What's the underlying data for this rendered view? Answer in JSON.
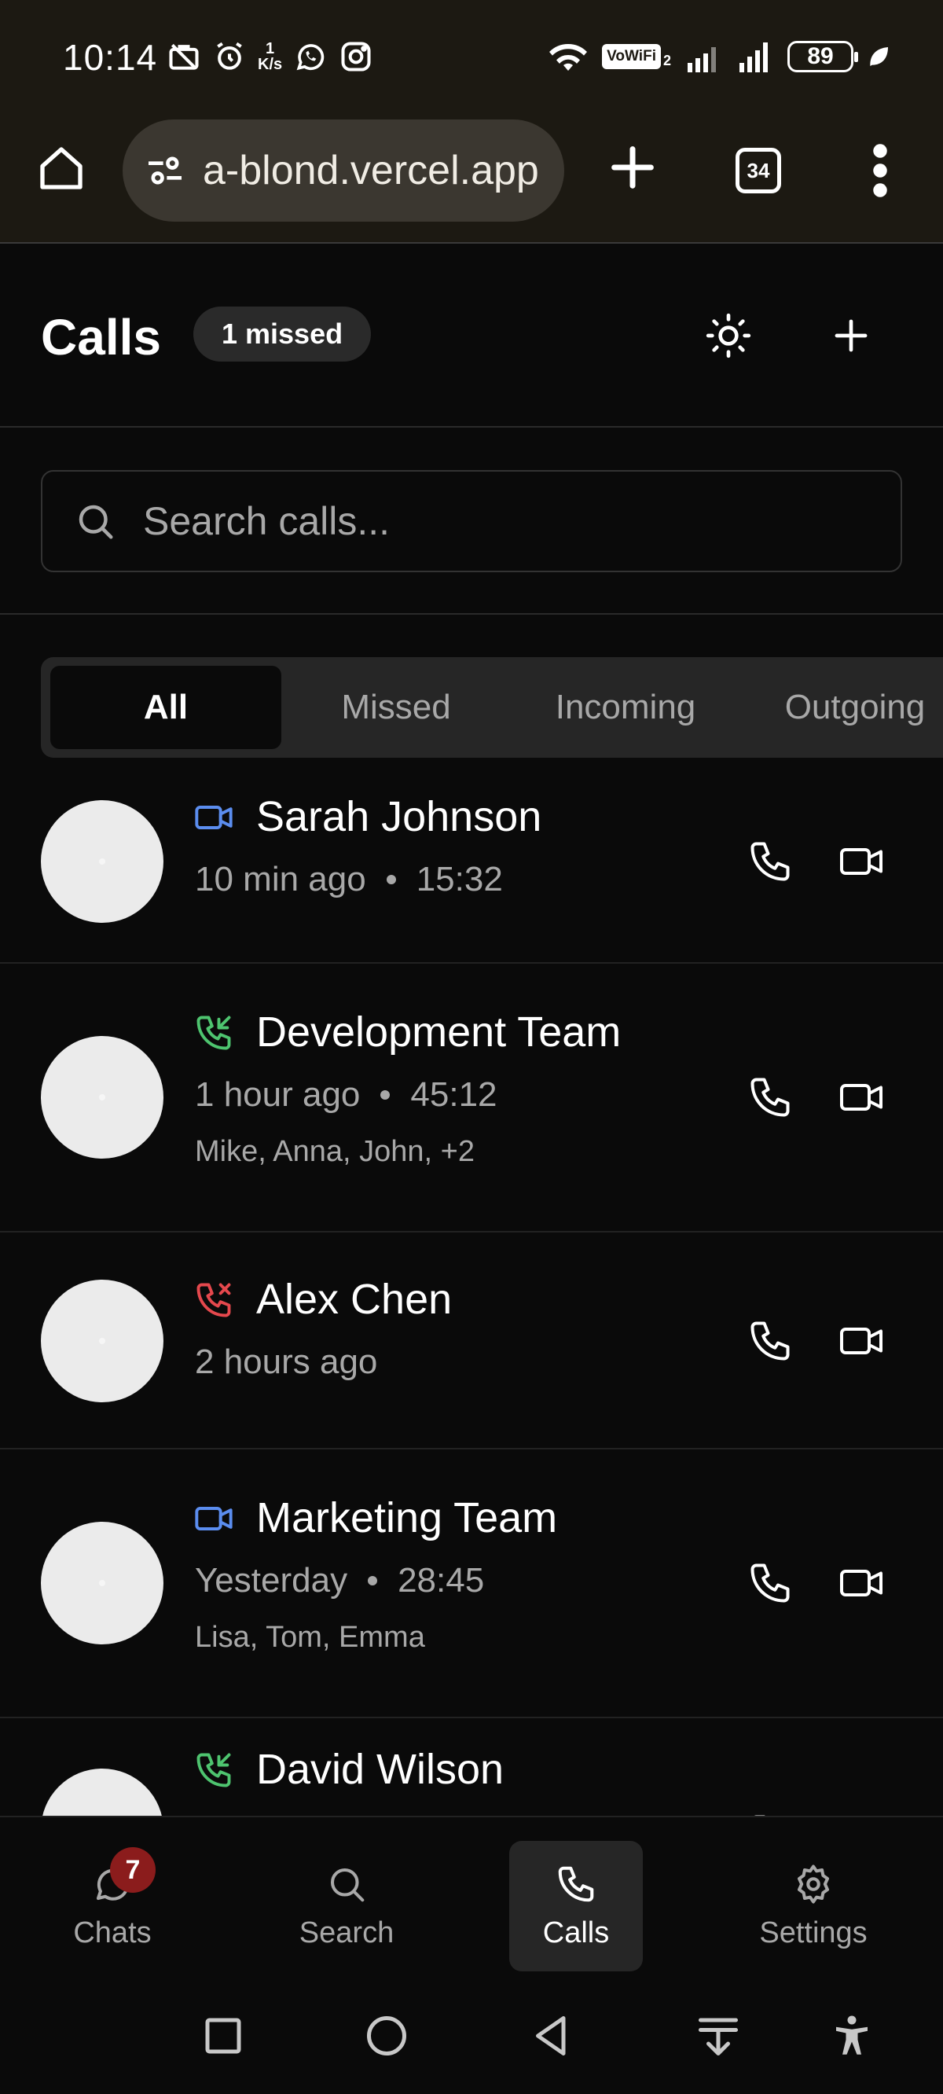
{
  "status_bar": {
    "time": "10:14",
    "speed_top": "1",
    "speed_unit": "K/s",
    "vowifi": "VoWiFi",
    "vowifi_sub": "2",
    "battery": "89"
  },
  "browser": {
    "url": "a-blond.vercel.app",
    "tab_count": "34"
  },
  "header": {
    "title": "Calls",
    "missed_badge": "1 missed"
  },
  "search": {
    "placeholder": "Search calls..."
  },
  "filter_tabs": [
    {
      "label": "All",
      "active": true
    },
    {
      "label": "Missed"
    },
    {
      "label": "Incoming"
    },
    {
      "label": "Outgoing"
    }
  ],
  "calls": [
    {
      "name": "Sarah Johnson",
      "type": "video",
      "time_ago": "10 min ago",
      "duration": "15:32",
      "participants": ""
    },
    {
      "name": "Development Team",
      "type": "incoming",
      "time_ago": "1 hour ago",
      "duration": "45:12",
      "participants": "Mike, Anna, John, +2"
    },
    {
      "name": "Alex Chen",
      "type": "missed",
      "time_ago": "2 hours ago",
      "duration": "",
      "participants": ""
    },
    {
      "name": "Marketing Team",
      "type": "video",
      "time_ago": "Yesterday",
      "duration": "28:45",
      "participants": "Lisa, Tom, Emma"
    },
    {
      "name": "David Wilson",
      "type": "incoming",
      "time_ago": "",
      "duration": "",
      "participants": ""
    }
  ],
  "bottom_nav": [
    {
      "label": "Chats",
      "icon": "chat-icon",
      "badge": "7"
    },
    {
      "label": "Search",
      "icon": "search-icon"
    },
    {
      "label": "Calls",
      "icon": "phone-icon",
      "active": true
    },
    {
      "label": "Settings",
      "icon": "gear-icon"
    }
  ],
  "colors": {
    "video": "#5b8def",
    "incoming": "#4ec46f",
    "missed": "#e5484d",
    "badge": "#8b1c1c",
    "background": "#0a0a0a"
  }
}
